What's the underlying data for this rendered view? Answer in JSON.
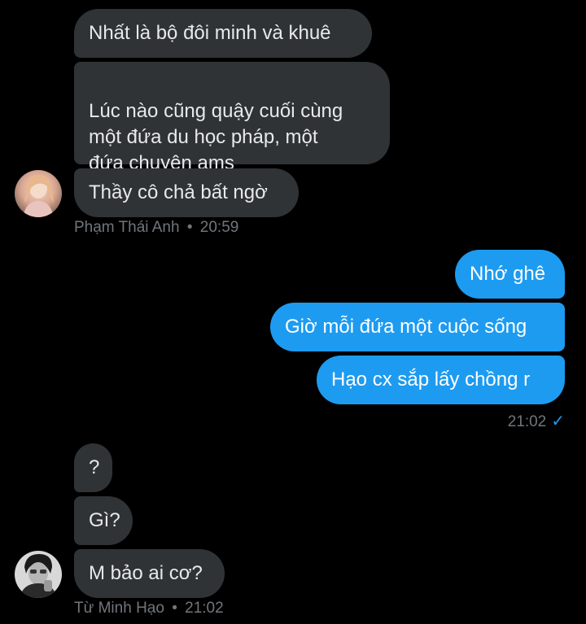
{
  "thread_a": {
    "messages": [
      {
        "text": "Nhất là bộ đôi minh và khuê"
      },
      {
        "text": "Lúc nào cũng quậy cuối cùng\nmột đứa du học pháp, một\nđứa chuyên ams"
      },
      {
        "text": "Thầy cô chả bất ngờ"
      }
    ],
    "sender": "Phạm Thái Anh",
    "separator": "•",
    "time": "20:59",
    "avatar_icon": "user-avatar-pink"
  },
  "outgoing": {
    "messages": [
      {
        "text": "Nhớ ghê"
      },
      {
        "text": "Giờ mỗi đứa một cuộc sống"
      },
      {
        "text": "Hạo cx sắp lấy chồng r"
      }
    ],
    "time": "21:02",
    "status_icon": "check-icon"
  },
  "thread_b": {
    "messages": [
      {
        "text": "?"
      },
      {
        "text": "Gì?"
      },
      {
        "text": "M bảo ai cơ?"
      }
    ],
    "sender": "Từ Minh Hạo",
    "separator": "•",
    "time": "21:02",
    "avatar_icon": "user-avatar-bw"
  },
  "colors": {
    "incoming_bubble": "#2f3336",
    "outgoing_bubble": "#1d9bf0",
    "meta_text": "#71767b"
  }
}
